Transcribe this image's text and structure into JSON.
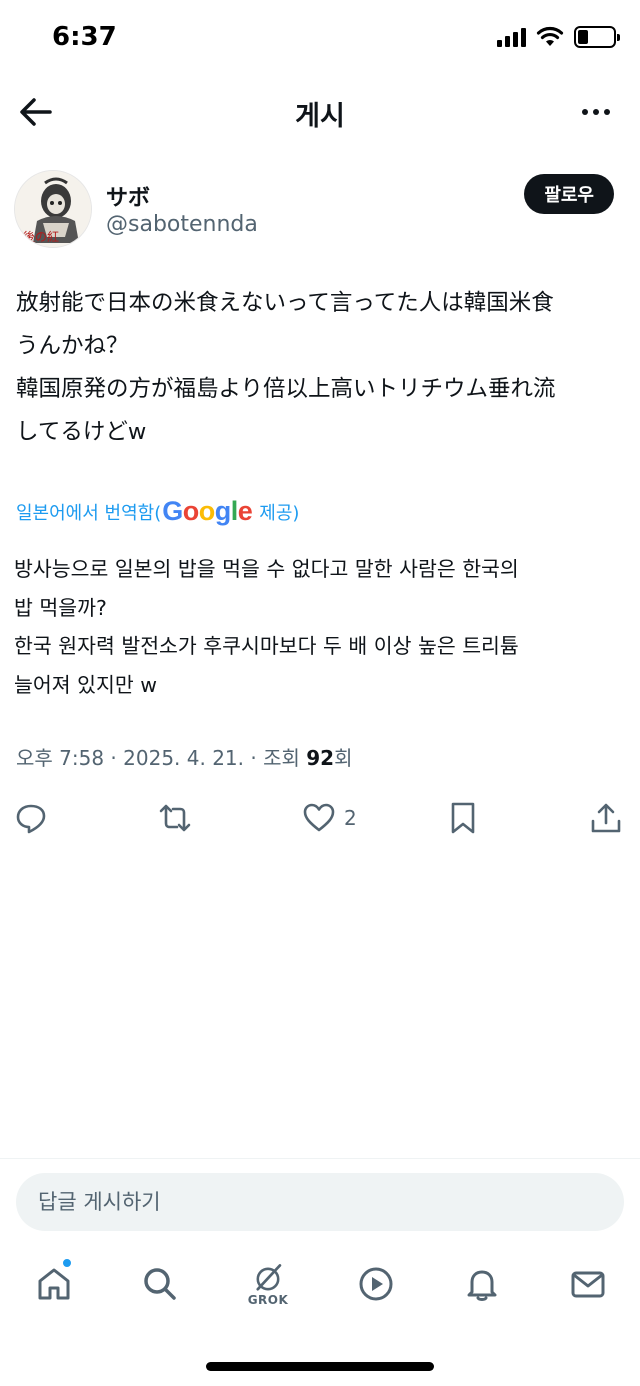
{
  "status_bar": {
    "time": "6:37",
    "battery_level": 0.3
  },
  "header": {
    "title": "게시",
    "back_icon": "arrow-left-icon",
    "more_icon": "more-horizontal-icon"
  },
  "author": {
    "display_name": "サボ",
    "handle": "@sabotennda",
    "follow_label": "팔로우",
    "avatar_text": "後の紅"
  },
  "tweet": {
    "text": "放射能で日本の米食えないって言ってた人は韓国米食\nうんかね？\n韓国原発の方が福島より倍以上高いトリチウム垂れ流\nしてるけどw",
    "translation_prefix": "일본어에서 번역함(",
    "translation_suffix": "제공)",
    "google_letters": [
      "G",
      "o",
      "o",
      "g",
      "l",
      "e"
    ],
    "translated_text": "방사능으로 일본의 밥을 먹을 수 없다고 말한 사람은 한국의\n밥 먹을까?\n한국 원자력 발전소가 후쿠시마보다 두 배 이상 높은 트리튬\n늘어져 있지만 w",
    "meta_prefix": "오후 7:58 · 2025. 4. 21. · 조회 ",
    "views": "92",
    "meta_suffix": "회"
  },
  "actions": {
    "reply_icon": "reply-icon",
    "repost_icon": "repost-icon",
    "like_icon": "heart-icon",
    "like_count": "2",
    "bookmark_icon": "bookmark-icon",
    "share_icon": "share-icon"
  },
  "reply_bar": {
    "placeholder": "답글 게시하기"
  },
  "bottom_nav": {
    "items": [
      "home-icon",
      "search-icon",
      "grok-icon",
      "video-icon",
      "notifications-icon",
      "messages-icon"
    ],
    "grok_label": "GROK"
  },
  "colors": {
    "accent": "#1d9bf0",
    "text": "#0f1419",
    "secondary": "#536471",
    "google_blue": "#4285F4",
    "google_red": "#EA4335",
    "google_yellow": "#FBBC05",
    "google_green": "#34A853"
  }
}
